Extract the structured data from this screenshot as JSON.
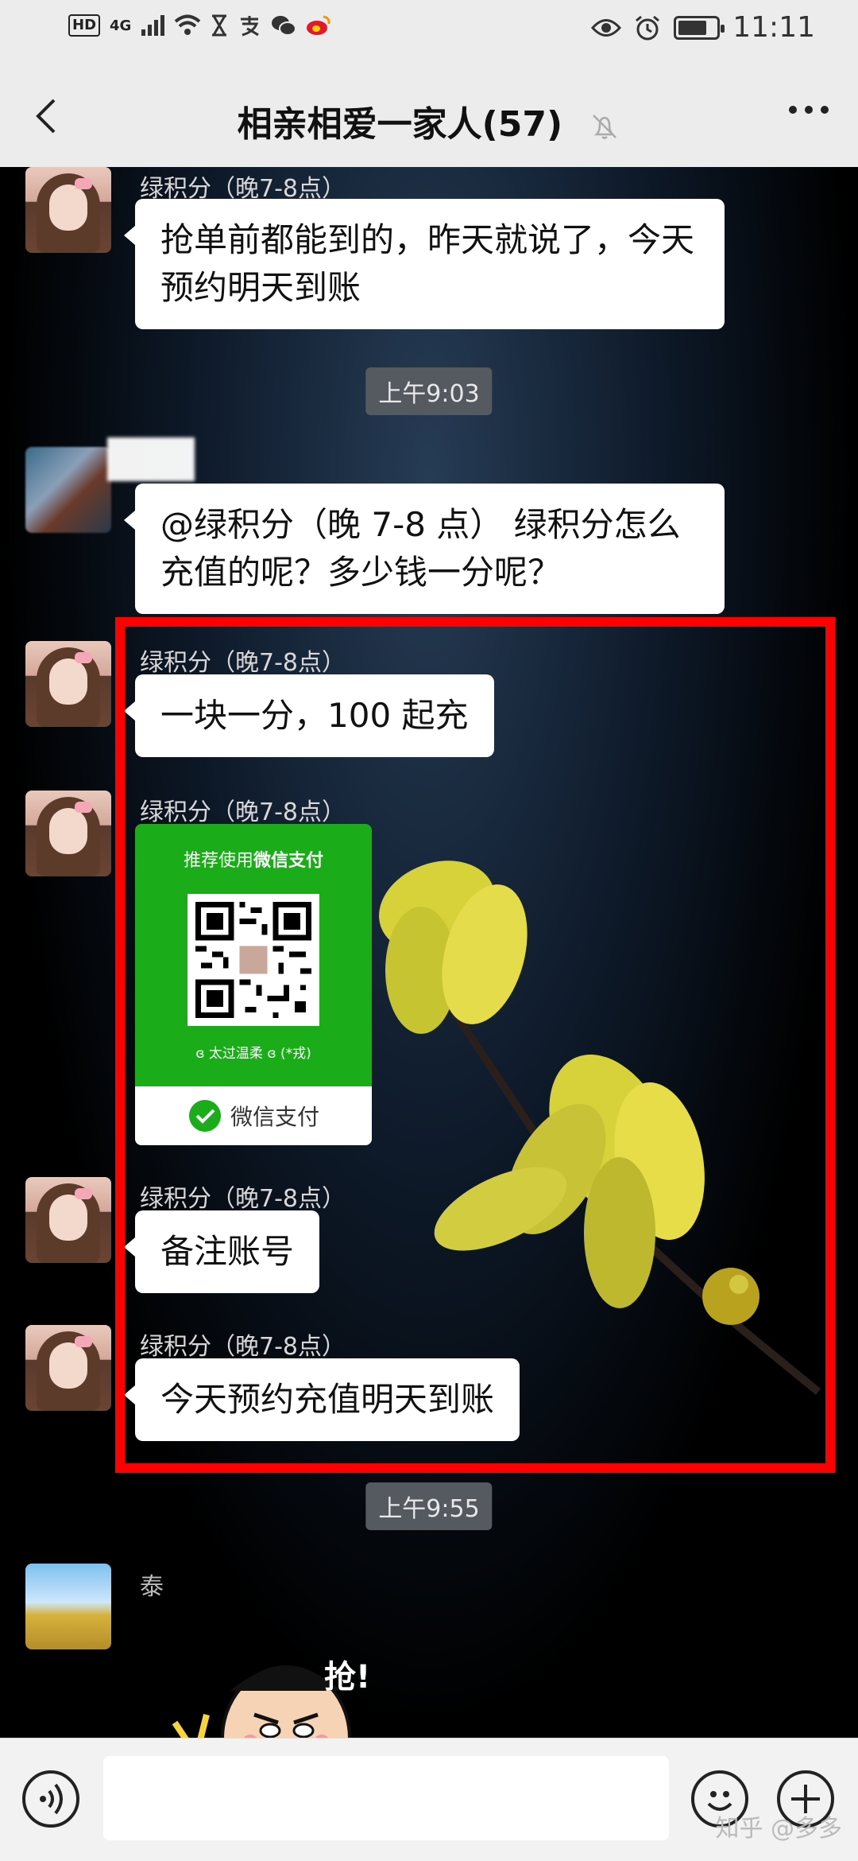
{
  "status_bar": {
    "hd": "HD",
    "network": "4G",
    "time": "11:11",
    "battery_level": 0.75
  },
  "header": {
    "title": "相亲相爱一家人(57)"
  },
  "messages": [
    {
      "sender": "绿积分（晚7-8点）",
      "text": "抢单前都能到的，昨天就说了，今天预约明天到账"
    },
    {
      "timestamp": "上午9:03"
    },
    {
      "sender": "",
      "text": "@绿积分（晚 7-8 点） 绿积分怎么充值的呢？多少钱一分呢？"
    },
    {
      "sender": "绿积分（晚7-8点）",
      "text": "一块一分，100 起充"
    },
    {
      "sender": "绿积分（晚7-8点）",
      "qr_card": {
        "top_text_prefix": "推荐使用",
        "top_text_bold": "微信支付",
        "owner_name": "ɞ 太过温柔 ɞ (*戎)",
        "footer": "微信支付"
      }
    },
    {
      "sender": "绿积分（晚7-8点）",
      "text": "备注账号"
    },
    {
      "sender": "绿积分（晚7-8点）",
      "text": "今天预约充值明天到账"
    },
    {
      "timestamp": "上午9:55"
    },
    {
      "sender": "泰",
      "sticker_text": "抢!"
    }
  ],
  "watermark": "知乎 @多多",
  "colors": {
    "highlight": "#ff0000",
    "wechat_green": "#1aad19"
  }
}
